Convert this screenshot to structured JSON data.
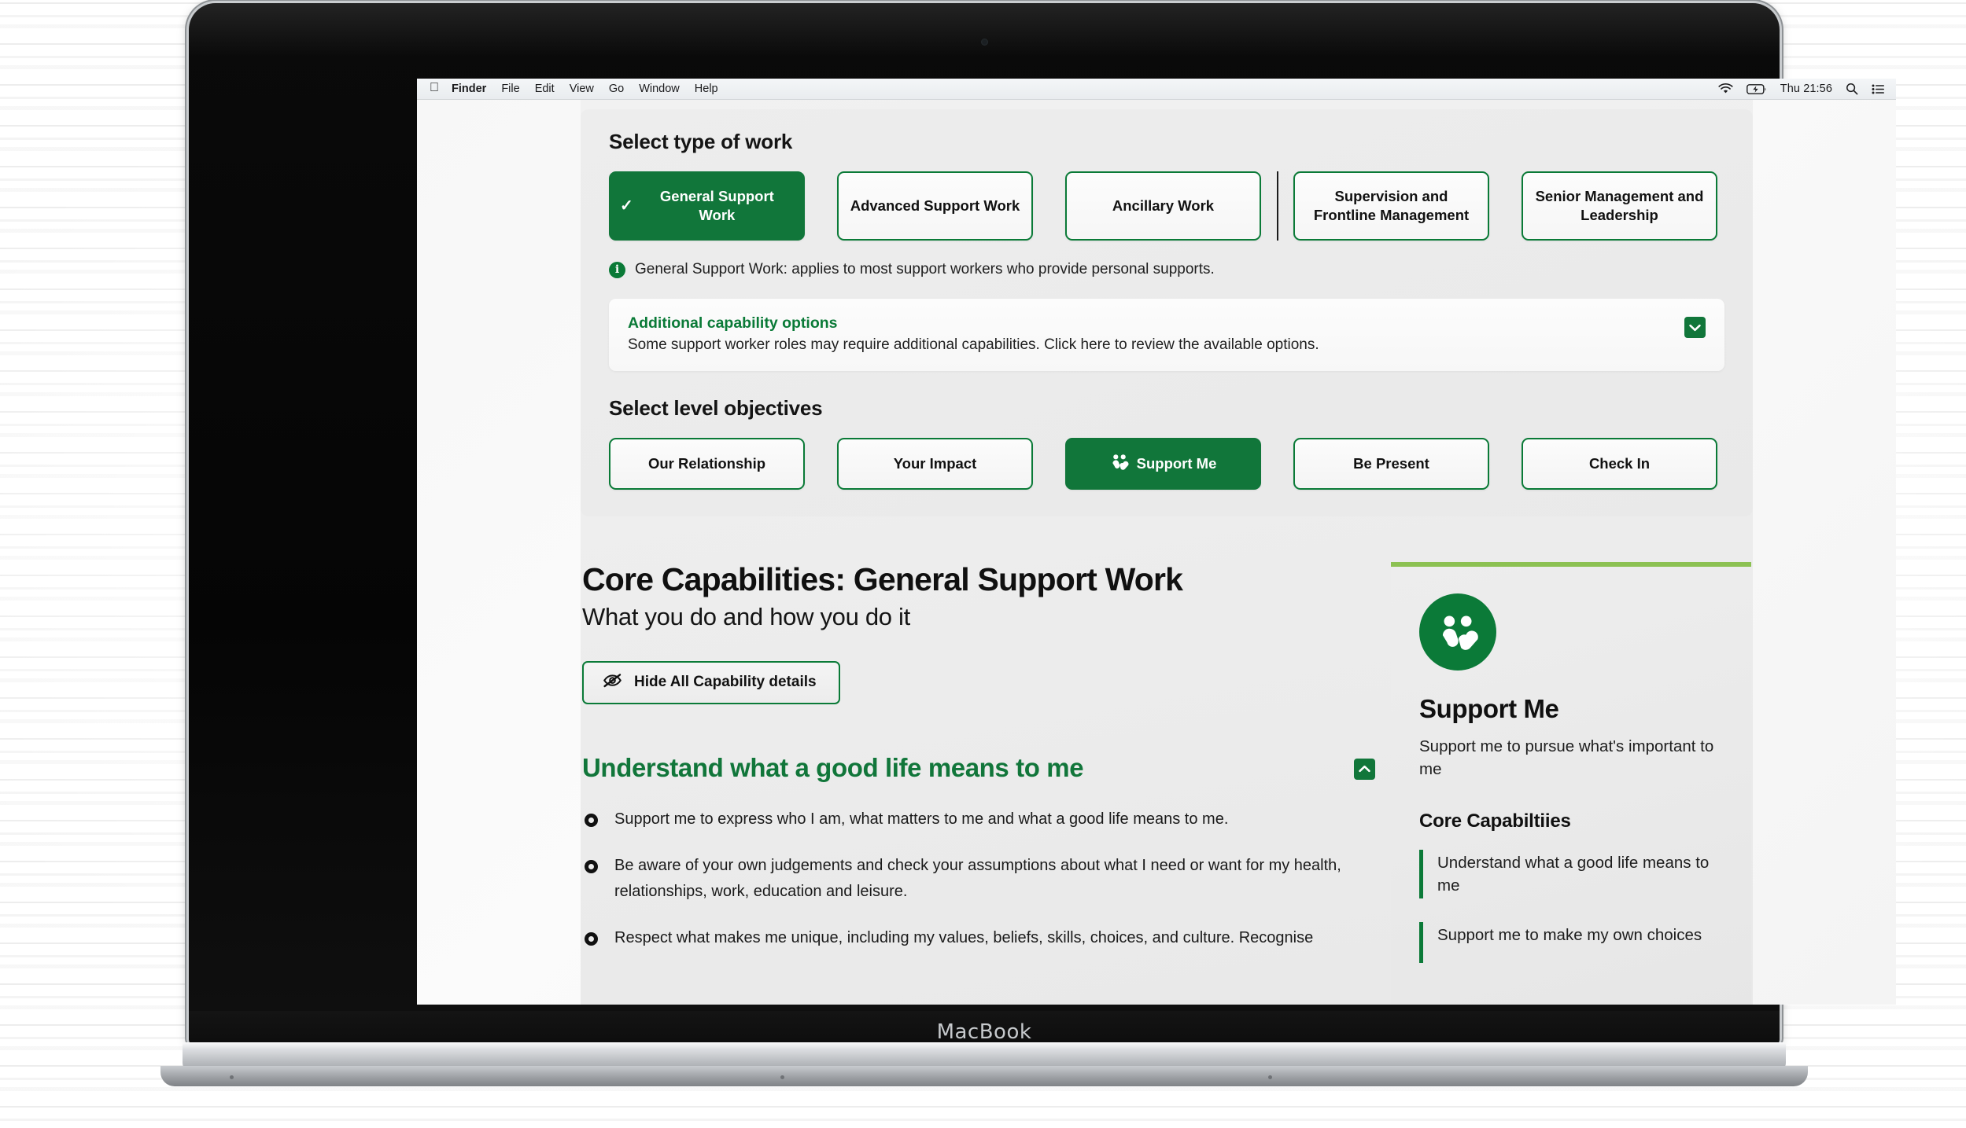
{
  "device": {
    "brand_label": "MacBook"
  },
  "menubar": {
    "apple_glyph": "",
    "items": [
      {
        "label": "Finder",
        "bold": true
      },
      {
        "label": "File",
        "bold": false
      },
      {
        "label": "Edit",
        "bold": false
      },
      {
        "label": "View",
        "bold": false
      },
      {
        "label": "Go",
        "bold": false
      },
      {
        "label": "Window",
        "bold": false
      },
      {
        "label": "Help",
        "bold": false
      }
    ],
    "status": {
      "wifi": "wifi-icon",
      "battery": "battery-charging-icon",
      "clock": "Thu 21:56",
      "search": "search-icon",
      "control_center": "control-center-icon"
    }
  },
  "selector": {
    "type_of_work_title": "Select type of work",
    "type_of_work_options": [
      {
        "label": "General Support Work",
        "selected": true
      },
      {
        "label": "Advanced Support Work",
        "selected": false
      },
      {
        "label": "Ancillary Work",
        "selected": false
      },
      {
        "label": "Supervision and Frontline Management",
        "selected": false
      },
      {
        "label": "Senior Management and Leadership",
        "selected": false
      }
    ],
    "info_text": "General Support Work: applies to most support workers who provide personal supports.",
    "additional": {
      "title": "Additional capability options",
      "description": "Some support worker roles may require additional capabilities. Click here to review the available options.",
      "toggle_icon": "chevron-down-icon"
    },
    "level_objectives_title": "Select level objectives",
    "level_objectives": [
      {
        "label": "Our Relationship",
        "selected": false,
        "icon": null
      },
      {
        "label": "Your Impact",
        "selected": false,
        "icon": null
      },
      {
        "label": "Support Me",
        "selected": true,
        "icon": "two-people-icon"
      },
      {
        "label": "Be Present",
        "selected": false,
        "icon": null
      },
      {
        "label": "Check In",
        "selected": false,
        "icon": null
      }
    ]
  },
  "main": {
    "title": "Core Capabilities: General Support Work",
    "subtitle": "What you do and how you do it",
    "hide_button": {
      "label": "Hide All Capability details",
      "icon": "eye-slash-icon"
    },
    "capability": {
      "heading": "Understand what a good life means to me",
      "collapse_icon": "chevron-up-icon",
      "bullets": [
        "Support me to express who I am, what matters to me and what a good life means to me.",
        "Be aware of your own judgements and check your assumptions about what I need or want for my health, relationships, work, education and leisure.",
        "Respect what makes me unique, including my values, beliefs, skills, choices, and culture. Recognise"
      ]
    }
  },
  "sidebar": {
    "icon": "two-people-circle-icon",
    "title": "Support Me",
    "description": "Support me to pursue what's important to me",
    "core_caps_heading": "Core Capabiltiies",
    "core_caps": [
      "Understand what a good life means to me",
      "Support me to make my own choices"
    ]
  },
  "colors": {
    "brand_green": "#11763a",
    "accent_green": "#0a7a37",
    "card_top_green": "#8cc152"
  }
}
